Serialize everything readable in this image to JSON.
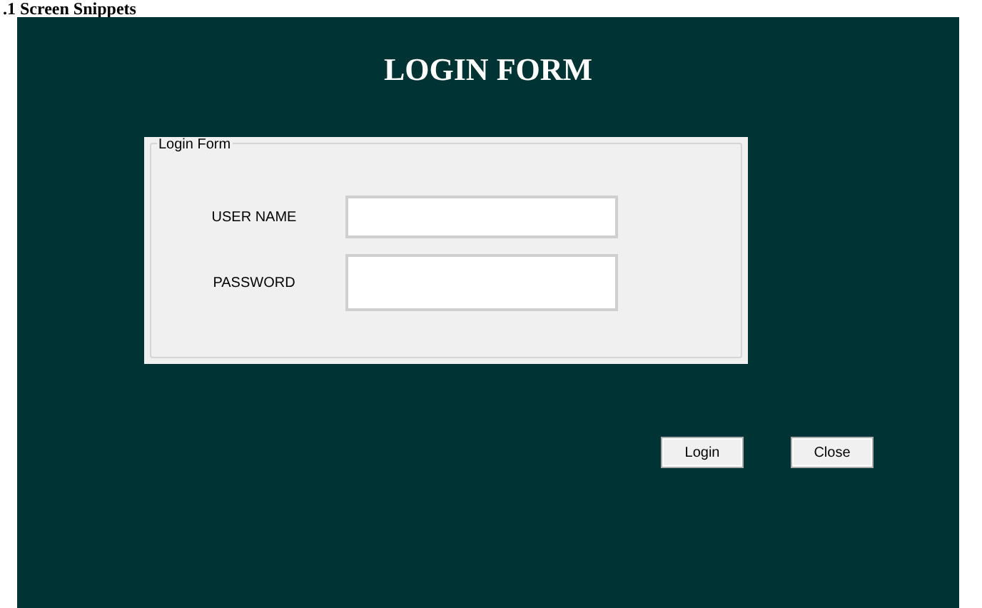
{
  "document_heading": ".1 Screen Snippets",
  "window": {
    "title": "LOGIN FORM"
  },
  "group": {
    "legend": "Login Form",
    "fields": [
      {
        "label": "USER NAME",
        "kind": "text"
      },
      {
        "label": "PASSWORD",
        "kind": "password"
      }
    ]
  },
  "buttons": [
    "Login",
    "Close"
  ]
}
